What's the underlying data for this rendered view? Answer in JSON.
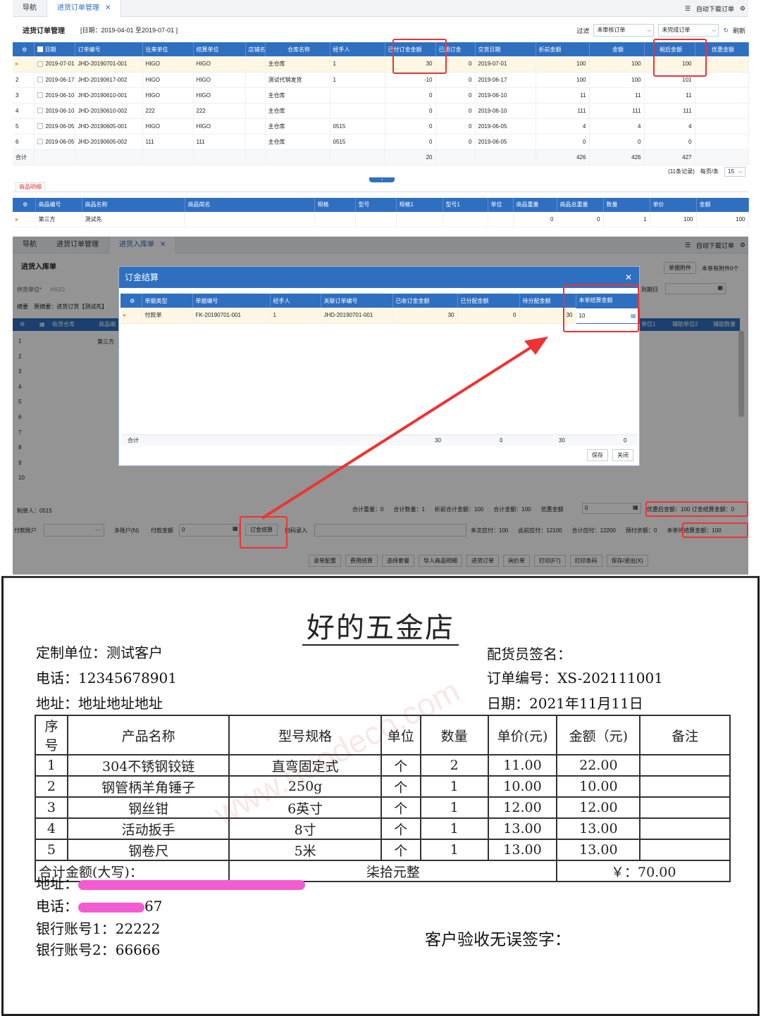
{
  "top": {
    "tabs": [
      {
        "label": "导航"
      },
      {
        "label": "进货订单管理"
      }
    ],
    "right_tools": {
      "auto_download": "自动下载订单"
    },
    "header": {
      "title": "进货订单管理",
      "date_range": "[日期：2019-04-01 至2019-07-01 ]"
    },
    "filter": {
      "label": "过滤",
      "option1": "未审核订单",
      "option2": "未完成订单",
      "refresh": "刷新"
    },
    "columns": [
      "日期",
      "订单编号",
      "往来单位",
      "结算单位",
      "店铺名称",
      "仓库名称",
      "经手人",
      "已付订金金额",
      "已用订金",
      "交货日期",
      "折前金额",
      "金额",
      "税后金额",
      "优惠金额"
    ],
    "rows": [
      [
        "1",
        "2019-07-01",
        "JHD-20190701-001",
        "HIGO",
        "HIGO",
        "",
        "主仓库",
        "1",
        "30",
        "0",
        "2019-07-01",
        "100",
        "100",
        "100"
      ],
      [
        "2",
        "2019-06-17",
        "JHD-20190617-002",
        "HIGO",
        "HIGO",
        "",
        "测试代销发货",
        "1",
        "-10",
        "0",
        "2019-06-17",
        "100",
        "100",
        "101"
      ],
      [
        "3",
        "2019-06-10",
        "JHD-20190610-001",
        "HIGO",
        "HIGO",
        "",
        "主仓库",
        "",
        "0",
        "0",
        "2019-06-10",
        "11",
        "11",
        "11"
      ],
      [
        "4",
        "2019-06-10",
        "JHD-20190610-002",
        "222",
        "222",
        "",
        "主仓库",
        "",
        "0",
        "0",
        "2019-06-10",
        "111",
        "111",
        "111"
      ],
      [
        "5",
        "2019-06-05",
        "JHD-20190605-001",
        "HIGO",
        "HIGO",
        "",
        "主仓库",
        "0515",
        "0",
        "0",
        "2019-06-05",
        "4",
        "4",
        "4"
      ],
      [
        "6",
        "2019-06-05",
        "JHD-20190605-002",
        "111",
        "111",
        "",
        "主仓库",
        "0515",
        "0",
        "0",
        "2019-06-05",
        "0",
        "0",
        "0"
      ]
    ],
    "sum": {
      "label": "合计",
      "paid": "20",
      "pre": "426",
      "amt": "426",
      "tax": "427"
    },
    "pager": {
      "records": "(11条记录)",
      "per_page_label": "每页/条",
      "per_page": "15"
    },
    "detail_tab": "商品明细",
    "detail_columns": [
      "商品编号",
      "商品名称",
      "商品简名",
      "规格",
      "型号",
      "规格1",
      "型号1",
      "单位",
      "商品重量",
      "商品总重量",
      "数量",
      "单价",
      "金额"
    ],
    "detail_row": [
      "第三方",
      "测试先",
      "",
      "",
      "",
      "",
      "",
      "",
      "0",
      "0",
      "1",
      "100",
      "100"
    ]
  },
  "bottom": {
    "tabs": [
      {
        "label": "导航"
      },
      {
        "label": "进货订单管理"
      },
      {
        "label": "进货入库单"
      }
    ],
    "auto_download": "自动下载订单",
    "title": "进货入库单",
    "attach": "单据附件",
    "attach_count": "本单有附件0个",
    "supplier_label": "供货单位",
    "supplier_value": "HIGO",
    "summary_label": "摘要",
    "summary_value": "原摘要：进货订货【测试先】",
    "cols": [
      "收货仓库",
      "商品编"
    ],
    "aux_cols": [
      "单位1",
      "辅助单位2",
      "辅助数量"
    ],
    "row_text": "第三方",
    "settle_date": "到期日",
    "rows": [
      "1",
      "2",
      "3",
      "4",
      "5",
      "6",
      "7",
      "8",
      "9",
      "10"
    ],
    "maker": "制单人：0515",
    "totals": {
      "weight": "合计重量：0",
      "qty": "合计数量：1",
      "disc_total": "折前合计金额：100",
      "total": "合计金额：100",
      "disc": "优惠金额",
      "disc_value": "0",
      "after_disc": "优惠后金额：100",
      "deposit_settle": "订金结算金额：0"
    },
    "payline": {
      "account": "付款账户",
      "multi": "多账户(N)",
      "payamt": "付款金额",
      "payval": "0",
      "deposit_btn": "订金结算",
      "scan": "扫码录入",
      "due": "本次应付：100",
      "prev": "此前应付：12100",
      "sum_due": "合计应付：12200",
      "prepay": "预付余额：0",
      "pending": "本单待结算金额：100"
    },
    "buttons": [
      "录单配置",
      "费用结算",
      "选择套餐",
      "导入商品明细",
      "进货订单",
      "询价单",
      "打印(F7)",
      "打印条码",
      "保存/退出(X)"
    ]
  },
  "modal": {
    "title": "订金结算",
    "columns": [
      "单据类型",
      "单据编号",
      "经手人",
      "关联订单编号",
      "已收订金金额",
      "已分配金额",
      "待分配金额",
      "本单结算金额"
    ],
    "row": [
      "付款单",
      "FK-20190701-001",
      "1",
      "JHD-20190701-001",
      "30",
      "0",
      "30",
      "10"
    ],
    "sum": {
      "label": "合计",
      "a": "30",
      "b": "0",
      "c": "30",
      "d": "0"
    },
    "save": "保存",
    "close": "关闭"
  },
  "receipt": {
    "title": "好的五金店",
    "customer": "定制单位：测试客户",
    "phone": "电话：12345678901",
    "address": "地址：地址地址地址",
    "picker": "配货员签名：",
    "order_no": "订单编号：XS-202111001",
    "date": "日期：2021年11月11日",
    "headers": [
      "序号",
      "产品名称",
      "型号规格",
      "单位",
      "数量",
      "单价(元)",
      "金额（元)",
      "备注"
    ],
    "items": [
      [
        "1",
        "304不锈钢铰链",
        "直弯固定式",
        "个",
        "2",
        "11.00",
        "22.00",
        ""
      ],
      [
        "2",
        "钢管柄羊角锤子",
        "250g",
        "个",
        "1",
        "10.00",
        "10.00",
        ""
      ],
      [
        "3",
        "钢丝钳",
        "6英寸",
        "个",
        "1",
        "12.00",
        "12.00",
        ""
      ],
      [
        "4",
        "活动扳手",
        "8寸",
        "个",
        "1",
        "13.00",
        "13.00",
        ""
      ],
      [
        "5",
        "钢卷尺",
        "5米",
        "个",
        "1",
        "13.00",
        "13.00",
        ""
      ]
    ],
    "total_label": "合计金额(大写)：",
    "total_words": "柒拾元整",
    "total_num": "￥：70.00",
    "addr2_label": "地址：",
    "phone2_label": "电话：",
    "phone2_suffix": "67",
    "bank1": "银行账号1：22222",
    "bank2": "银行账号2：66666",
    "sign": "客户验收无误签字：",
    "watermark": "www.huodeco.com"
  }
}
